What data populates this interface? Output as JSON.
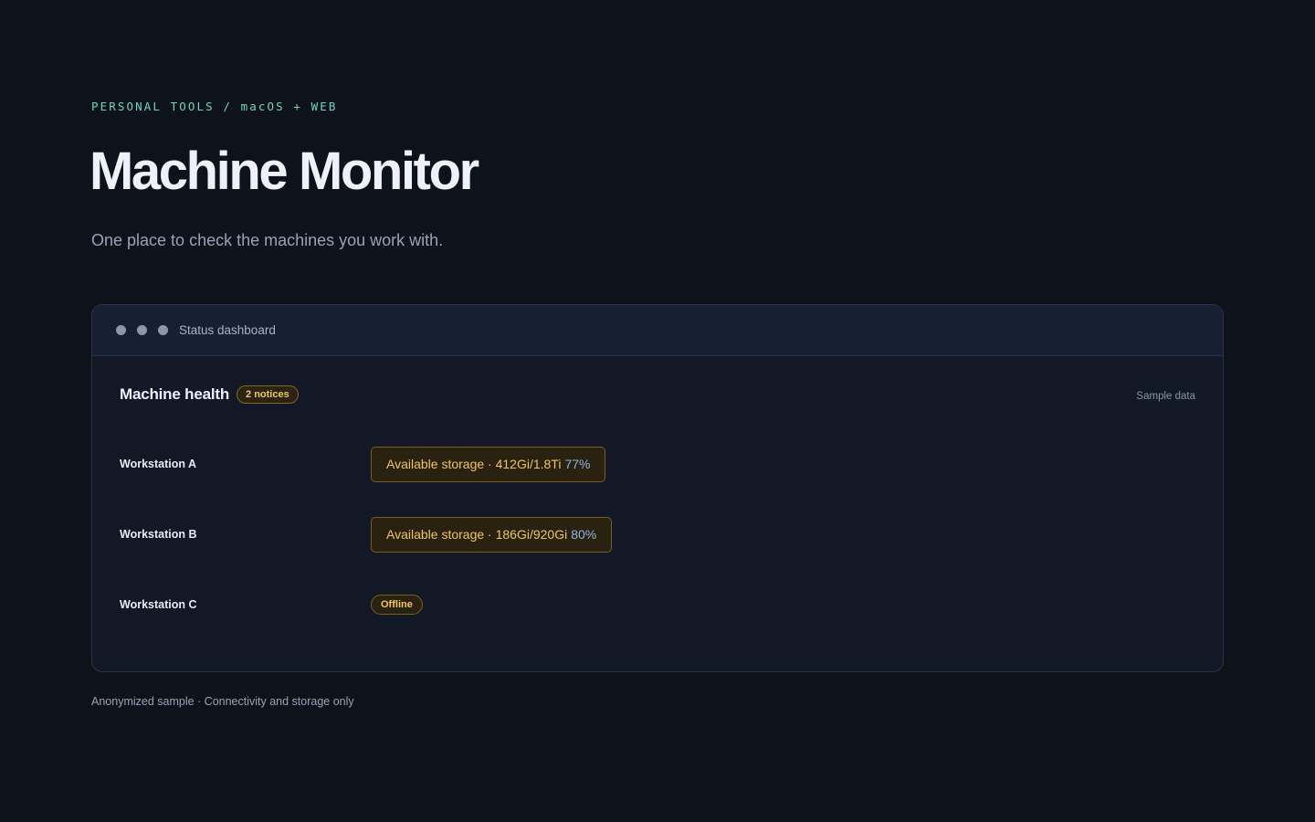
{
  "header": {
    "eyebrow": "PERSONAL TOOLS / macOS + WEB",
    "title": "Machine Monitor",
    "subtitle": "One place to check the machines you work with."
  },
  "window": {
    "title": "Status dashboard"
  },
  "panel": {
    "title": "Machine health",
    "notice_badge": "2 notices",
    "sample_label": "Sample data"
  },
  "machines": [
    {
      "name": "Workstation A",
      "storage_text": "Available storage · 412Gi/1.8Ti",
      "storage_pct": "77%"
    },
    {
      "name": "Workstation B",
      "storage_text": "Available storage · 186Gi/920Gi",
      "storage_pct": "80%"
    },
    {
      "name": "Workstation C",
      "status": "Offline"
    }
  ],
  "footer": {
    "note": "Anonymized sample · Connectivity and storage only"
  },
  "colors": {
    "background": "#0e121b",
    "accent_teal": "#6fd3c3",
    "warning_amber": "#f0c45d",
    "percent_blue": "#8fb4e3"
  },
  "icons": [
    "window-dot-icon",
    "window-dot-icon",
    "window-dot-icon"
  ]
}
